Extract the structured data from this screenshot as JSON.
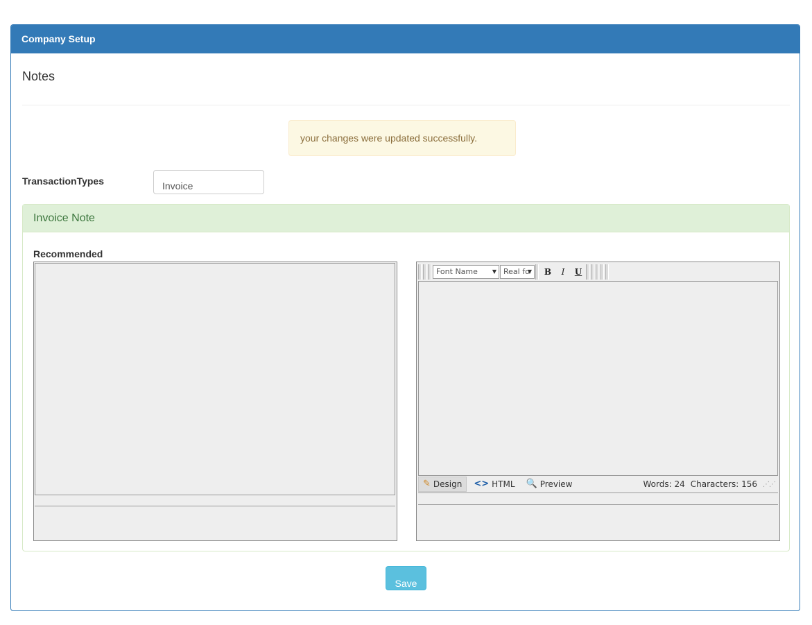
{
  "panel": {
    "title": "Company Setup"
  },
  "page": {
    "title": "Notes"
  },
  "alert": {
    "message": "your changes were updated successfully."
  },
  "transaction": {
    "label": "TransactionTypes",
    "selected": "Invoice"
  },
  "note_panel": {
    "title": "Invoice Note",
    "recommended_label": "Recommended"
  },
  "editor": {
    "font_name": "Font Name",
    "font_size": "Real fo",
    "bold": "B",
    "italic": "I",
    "underline": "U",
    "modes": {
      "design": "Design",
      "html": "HTML",
      "preview": "Preview"
    },
    "words": "Words: 24",
    "characters": "Characters: 156"
  },
  "actions": {
    "save": "Save"
  },
  "colors": {
    "primary": "#337ab7",
    "success_bg": "#dff0d8",
    "warning_bg": "#fcf8e3",
    "info": "#5bc0de"
  }
}
